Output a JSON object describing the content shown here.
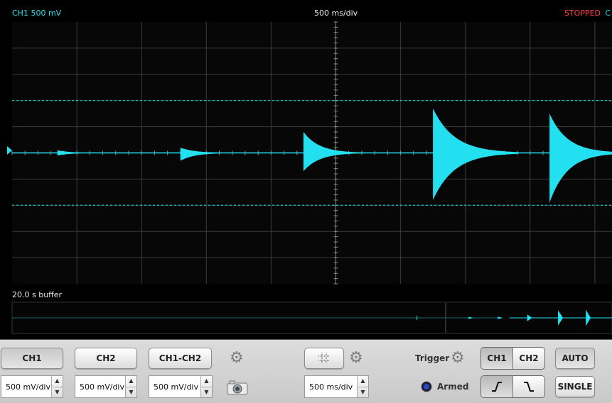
{
  "header": {
    "ch1_readout": "CH1 500 mV",
    "timebase": "500 ms/div",
    "status": "STOPPED",
    "status_extra": "C"
  },
  "buffer": {
    "label": "20.0 s buffer"
  },
  "colors": {
    "trace": "#22e0f0",
    "grid": "#3c3c3c",
    "status": "#ff4040",
    "background": "#000000"
  },
  "controls": {
    "ch1_button": "CH1",
    "ch2_button": "CH2",
    "ch1_minus_ch2_button": "CH1-CH2",
    "ch1_scale": "500 mV/div",
    "ch2_scale": "500 mV/div",
    "math_scale": "500 mV/div",
    "timebase_scale": "500 ms/div",
    "trigger_label": "Trigger",
    "trigger_ch1": "CH1",
    "trigger_ch2": "CH2",
    "armed_label": "Armed",
    "auto_button": "AUTO",
    "single_button": "SINGLE",
    "icons": [
      "gear-icon",
      "camera-icon",
      "grid-icon",
      "rising-edge-icon",
      "falling-edge-icon",
      "armed-indicator-icon"
    ]
  },
  "waveform": {
    "volts_per_div": 0.5,
    "seconds_per_div": 0.5,
    "cursor_levels_v": [
      1.0,
      -1.0
    ],
    "impulses": [
      {
        "t": 0.35,
        "peak_pos": 0.05,
        "peak_neg": -0.05,
        "decay": 0.18
      },
      {
        "t": 1.3,
        "peak_pos": 0.1,
        "peak_neg": -0.15,
        "decay": 0.2
      },
      {
        "t": 2.25,
        "peak_pos": 0.4,
        "peak_neg": -0.35,
        "decay": 0.22
      },
      {
        "t": 3.25,
        "peak_pos": 0.85,
        "peak_neg": -0.9,
        "decay": 0.3
      },
      {
        "t": 4.15,
        "peak_pos": 0.75,
        "peak_neg": -0.95,
        "decay": 0.25
      },
      {
        "t": 5.1,
        "peak_pos": 1.05,
        "peak_neg": -1.05,
        "decay": 0.4
      },
      {
        "t": 6.1,
        "peak_pos": 1.05,
        "peak_neg": -1.05,
        "decay": 0.4
      },
      {
        "t": 7.05,
        "peak_pos": 1.05,
        "peak_neg": -1.05,
        "decay": 0.45
      },
      {
        "t": 8.1,
        "peak_pos": 0.03,
        "peak_neg": -0.03,
        "decay": 0.1
      }
    ]
  }
}
